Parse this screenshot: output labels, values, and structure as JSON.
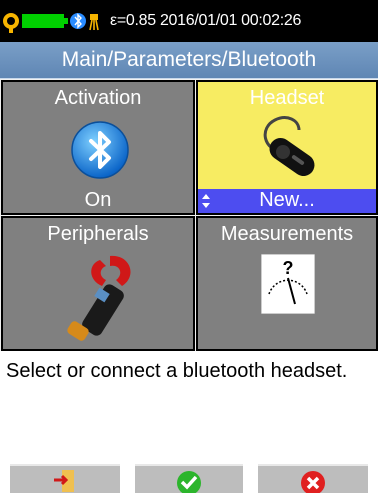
{
  "status": {
    "text": "ε=0.85  2016/01/01 00:02:26",
    "colors": {
      "battery": "#00d000",
      "bluetooth": "#2a8cff",
      "orange_icon": "#f7b500"
    }
  },
  "breadcrumb": "Main/Parameters/Bluetooth",
  "tiles": [
    {
      "title": "Activation",
      "icon": "bluetooth-icon",
      "value": "On"
    },
    {
      "title": "Headset",
      "icon": "headset-icon",
      "value": "New...",
      "selected": true
    },
    {
      "title": "Peripherals",
      "icon": "clamp-meter-icon"
    },
    {
      "title": "Measurements",
      "icon": "gauge-icon",
      "icon_text": "?"
    }
  ],
  "description": "Select or connect a bluetooth headset.",
  "footer": {
    "buttons": [
      {
        "icon": "exit-icon"
      },
      {
        "icon": "confirm-check-icon"
      },
      {
        "icon": "cancel-x-icon"
      }
    ]
  },
  "colors": {
    "selected_tile": "#f7ec62",
    "selection_bar": "#4d4df0",
    "breadcrumb": "#6f93bf",
    "tile": "#808080"
  }
}
